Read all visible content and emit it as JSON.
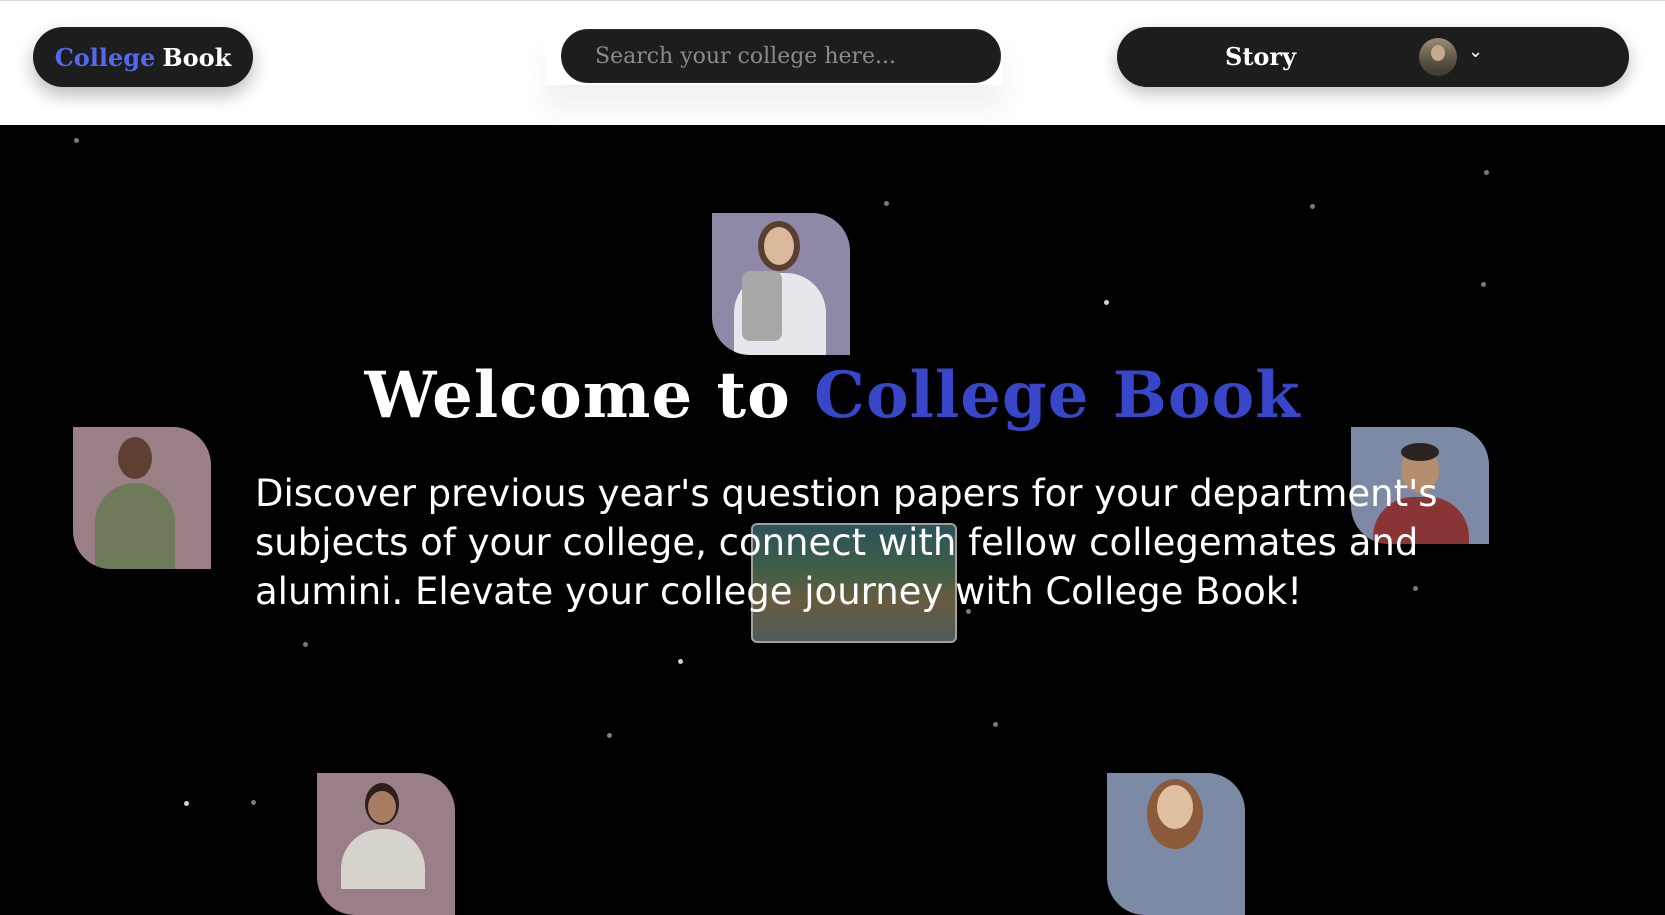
{
  "header": {
    "brand": {
      "part1": "College",
      "part2": "Book"
    },
    "search": {
      "placeholder": "Search your college here...",
      "value": ""
    },
    "story_label": "Story",
    "avatar_icon": "user-avatar",
    "chevron_icon": "chevron-down-icon"
  },
  "hero": {
    "title_prefix": "Welcome to",
    "title_accent": "College Book",
    "description": "Discover previous year's question papers for your department's subjects of your college, connect with fellow collegemates and alumini. Elevate your college journey with College Book!"
  },
  "colors": {
    "brand_accent": "#5667ee",
    "title_accent": "#3847c9",
    "pill_bg": "#1d1d1d",
    "hero_bg": "#000000"
  }
}
